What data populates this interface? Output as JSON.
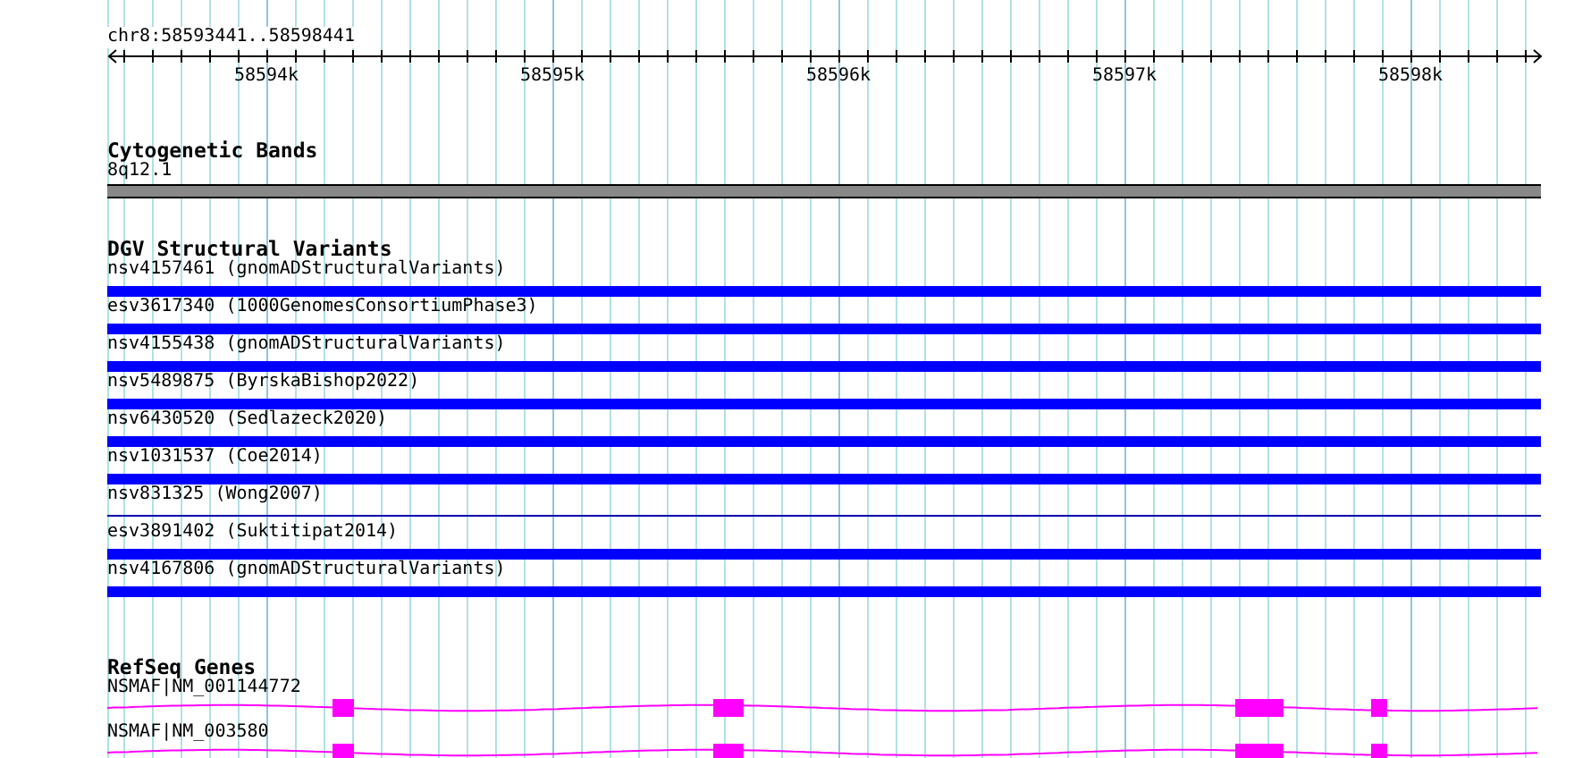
{
  "ruler": {
    "location": "chr8:58593441..58598441",
    "ticks": [
      "58594k",
      "58595k",
      "58596k",
      "58597k",
      "58598k"
    ]
  },
  "cytoband": {
    "title": "Cytogenetic Bands",
    "band": "8q12.1"
  },
  "dgv": {
    "title": "DGV Structural Variants",
    "variants": [
      {
        "label": "nsv4157461 (gnomADStructuralVariants)",
        "kind": "bar"
      },
      {
        "label": "esv3617340 (1000GenomesConsortiumPhase3)",
        "kind": "bar"
      },
      {
        "label": "nsv4155438 (gnomADStructuralVariants)",
        "kind": "bar"
      },
      {
        "label": "nsv5489875 (ByrskaBishop2022)",
        "kind": "bar"
      },
      {
        "label": "nsv6430520 (Sedlazeck2020)",
        "kind": "bar"
      },
      {
        "label": "nsv1031537 (Coe2014)",
        "kind": "bar"
      },
      {
        "label": "nsv831325 (Wong2007)",
        "kind": "line"
      },
      {
        "label": "esv3891402 (Suktitipat2014)",
        "kind": "bar"
      },
      {
        "label": "nsv4167806 (gnomADStructuralVariants)",
        "kind": "bar"
      }
    ]
  },
  "refseq": {
    "title": "RefSeq Genes",
    "transcripts": [
      {
        "label": "NSMAF|NM_001144772"
      },
      {
        "label": "NSMAF|NM_003580"
      }
    ]
  }
}
